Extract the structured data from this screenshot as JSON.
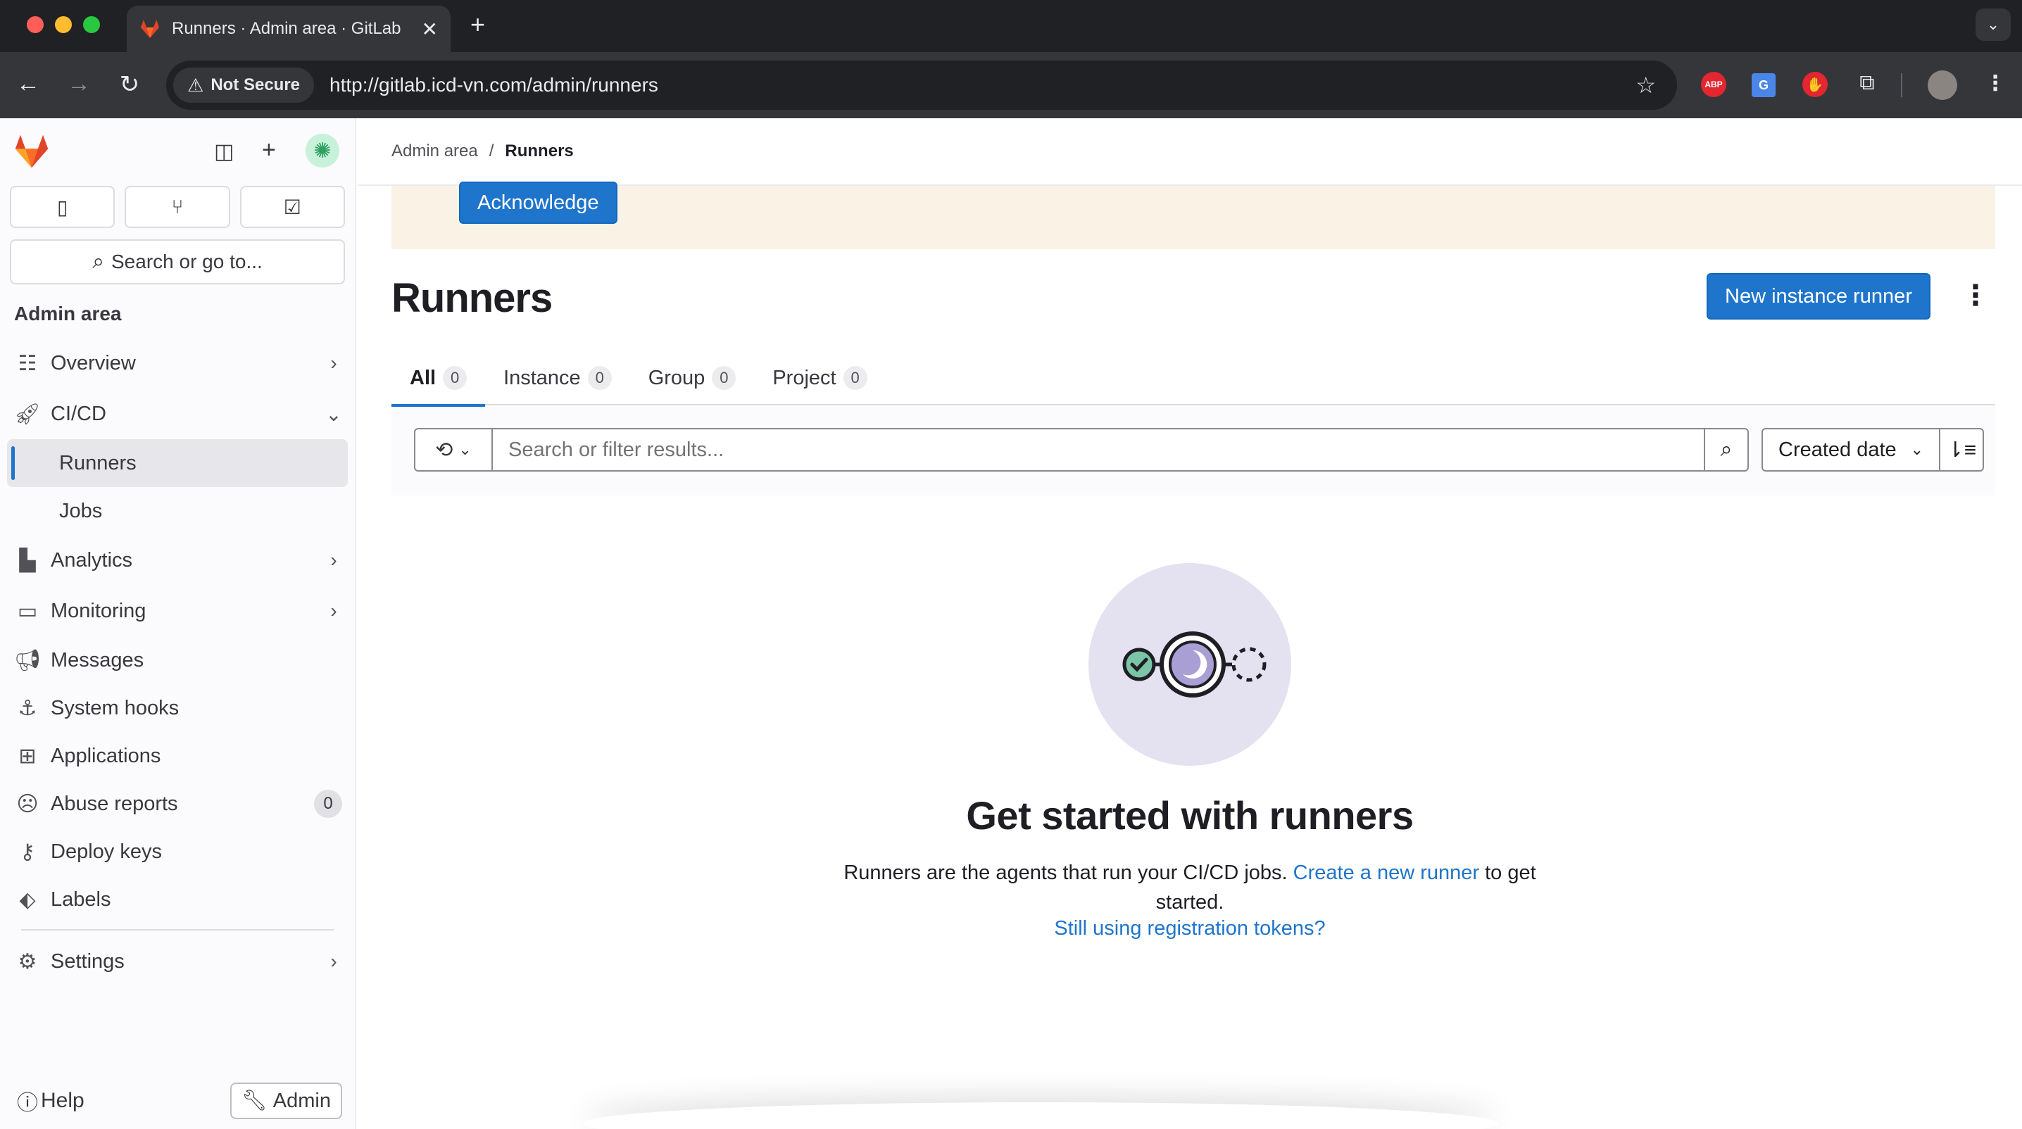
{
  "browser": {
    "tab_title": "Runners · Admin area · GitLab",
    "security_label": "Not Secure",
    "url": "http://gitlab.icd-vn.com/admin/runners",
    "extensions": [
      "ABP",
      "translate-icon",
      "hand-icon",
      "puzzle-icon"
    ]
  },
  "sidebar": {
    "search_placeholder": "Search or go to...",
    "section_title": "Admin area",
    "items": [
      {
        "label": "Overview",
        "icon": "overview-icon"
      },
      {
        "label": "CI/CD",
        "icon": "rocket-icon"
      },
      {
        "label": "Runners"
      },
      {
        "label": "Jobs"
      },
      {
        "label": "Analytics",
        "icon": "chart-icon"
      },
      {
        "label": "Monitoring",
        "icon": "monitor-icon"
      },
      {
        "label": "Messages",
        "icon": "megaphone-icon"
      },
      {
        "label": "System hooks",
        "icon": "anchor-icon"
      },
      {
        "label": "Applications",
        "icon": "grid-icon"
      },
      {
        "label": "Abuse reports",
        "icon": "frown-icon",
        "count": "0"
      },
      {
        "label": "Deploy keys",
        "icon": "key-icon"
      },
      {
        "label": "Labels",
        "icon": "label-icon"
      },
      {
        "label": "Settings",
        "icon": "gear-icon"
      }
    ],
    "help_label": "Help",
    "admin_label": "Admin"
  },
  "breadcrumb": {
    "parent": "Admin area",
    "separator": "/",
    "current": "Runners"
  },
  "alert": {
    "acknowledge_label": "Acknowledge"
  },
  "page": {
    "title": "Runners",
    "new_runner_label": "New instance runner"
  },
  "tabs": [
    {
      "label": "All",
      "count": "0"
    },
    {
      "label": "Instance",
      "count": "0"
    },
    {
      "label": "Group",
      "count": "0"
    },
    {
      "label": "Project",
      "count": "0"
    }
  ],
  "filter": {
    "placeholder": "Search or filter results...",
    "sort_label": "Created date"
  },
  "empty_state": {
    "title": "Get started with runners",
    "text_before": "Runners are the agents that run your CI/CD jobs. ",
    "link_text": "Create a new runner",
    "text_after": " to get started.",
    "secondary_link": "Still using registration tokens?"
  },
  "colors": {
    "accent": "#1f75cb",
    "alert_bg": "#fbf2e6",
    "illustration_bg": "#e4e1f0"
  }
}
